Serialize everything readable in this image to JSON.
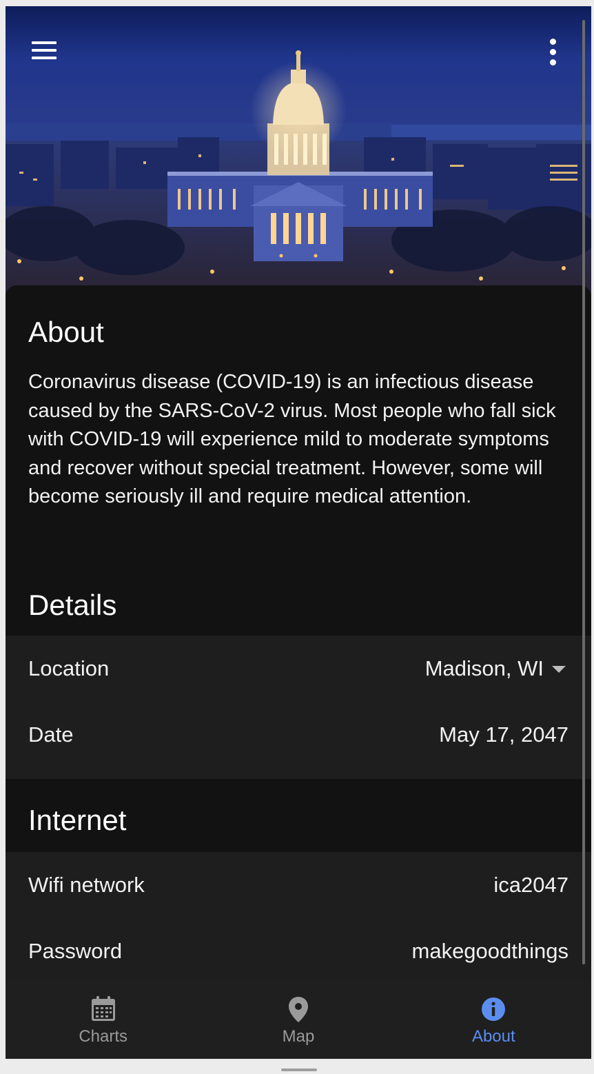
{
  "header": {
    "hero_image": "wisconsin-state-capitol-night-aerial",
    "menu_icon": "hamburger-menu-icon",
    "more_icon": "more-vertical-icon"
  },
  "about": {
    "title": "About",
    "body": "Coronavirus disease (COVID-19) is an infectious disease caused by the SARS-CoV-2 virus. Most people who fall sick with COVID-19 will experience mild to moderate symptoms and recover without special treatment. However, some will become seriously ill and require medical attention."
  },
  "details": {
    "title": "Details",
    "location_label": "Location",
    "location_value": "Madison, WI",
    "date_label": "Date",
    "date_value": "May 17, 2047"
  },
  "internet": {
    "title": "Internet",
    "wifi_label": "Wifi network",
    "wifi_value": "ica2047",
    "password_label": "Password",
    "password_value": "makegoodthings"
  },
  "nav": {
    "items": [
      {
        "label": "Charts",
        "icon": "calendar-icon"
      },
      {
        "label": "Map",
        "icon": "map-pin-icon"
      },
      {
        "label": "About",
        "icon": "info-icon"
      }
    ],
    "active_index": 2
  },
  "colors": {
    "background": "#121212",
    "card": "#1e1e1e",
    "nav_background": "#1f1f1f",
    "accent": "#5b8def",
    "inactive": "#9a9a9a"
  }
}
